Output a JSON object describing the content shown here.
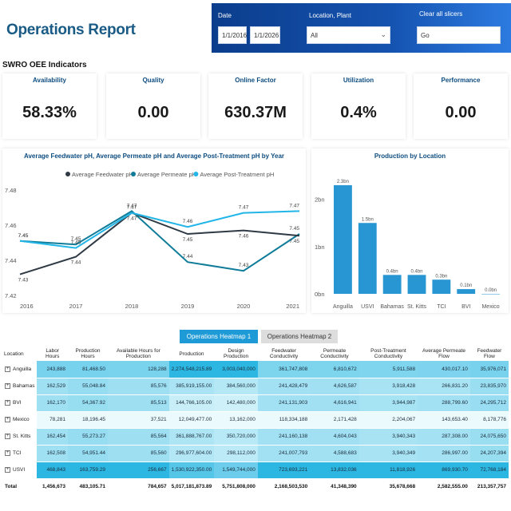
{
  "header": {
    "title": "Operations Report"
  },
  "slicers": {
    "date_label": "Date",
    "date_start": "1/1/2016",
    "date_end": "1/1/2026",
    "location_label": "Location, Plant",
    "location_value": "All",
    "clear_label": "Clear all slicers",
    "clear_button": "Go"
  },
  "kpis": {
    "section_title": "SWRO OEE Indicators",
    "items": [
      {
        "label": "Availability",
        "value": "58.33%"
      },
      {
        "label": "Quality",
        "value": "0.00"
      },
      {
        "label": "Online Factor",
        "value": "630.37M"
      },
      {
        "label": "Utilization",
        "value": "0.4%"
      },
      {
        "label": "Performance",
        "value": "0.00"
      }
    ]
  },
  "tabs": [
    {
      "label": "Operations Heatmap 1",
      "active": true
    },
    {
      "label": "Operations Heatmap 2",
      "active": false
    }
  ],
  "chart_data": [
    {
      "type": "line",
      "title": "Average Feedwater pH, Average Permeate pH and Average Post-Treatment pH by Year",
      "x": [
        "2016",
        "2017",
        "2018",
        "2019",
        "2020",
        "2021"
      ],
      "ylim": [
        7.42,
        7.48
      ],
      "yticks": [
        "7.48",
        "7.46",
        "7.44",
        "7.42"
      ],
      "legend_position": "top-center",
      "series": [
        {
          "name": "Average Feedwater pH",
          "color": "#2f3a45",
          "values": [
            7.432,
            7.442,
            7.467,
            7.455,
            7.457,
            7.454
          ],
          "labels": [
            "7.43",
            "7.44",
            "7.47",
            "7.45",
            "7.46",
            "7.45"
          ]
        },
        {
          "name": "Average Permeate pH",
          "color": "#0f7c99",
          "values": [
            7.451,
            7.449,
            7.468,
            7.439,
            7.434,
            7.455
          ],
          "labels": [
            "7.45",
            "7.45",
            "7.47",
            "7.44",
            "7.43",
            "7.45"
          ]
        },
        {
          "name": "Average Post-Treatment pH",
          "color": "#22b6e8",
          "values": [
            7.451,
            7.447,
            7.467,
            7.459,
            7.467,
            7.468
          ],
          "labels": [
            "7.45",
            "7.45",
            "7.47",
            "7.46",
            "7.47",
            "7.47"
          ]
        }
      ]
    },
    {
      "type": "bar",
      "title": "Production by Location",
      "categories": [
        "Anguilla",
        "USVI",
        "Bahamas",
        "St. Kitts",
        "TCI",
        "BVI",
        "Mexico"
      ],
      "values": [
        2.3,
        1.5,
        0.4,
        0.4,
        0.3,
        0.1,
        0.0
      ],
      "labels": [
        "2.3bn",
        "1.5bn",
        "0.4bn",
        "0.4bn",
        "0.3bn",
        "0.1bn",
        "0.0bn"
      ],
      "ylim": [
        0,
        2.4
      ],
      "yticks": [
        "0bn",
        "1bn",
        "2bn"
      ],
      "color": "#2796d3"
    }
  ],
  "heatmap": {
    "columns": [
      "Location",
      "Labor Hours",
      "Production Hours",
      "Available Hours for Production",
      "Production",
      "Design Production",
      "Feedwater Conductivity",
      "Permeate Conductivity",
      "Post-Treatment Conductivity",
      "Average Permeate Flow",
      "Feedwater Flow"
    ],
    "rows": [
      [
        "Anguilla",
        "243,888",
        "81,468.50",
        "128,288",
        "2,274,548,215.89",
        "3,003,040,000",
        "361,747,808",
        "6,810,672",
        "5,911,588",
        "430,017.10",
        "35,976,071"
      ],
      [
        "Bahamas",
        "162,529",
        "55,048.84",
        "85,576",
        "385,919,155.00",
        "384,560,000",
        "241,428,479",
        "4,626,587",
        "3,918,428",
        "266,831.20",
        "23,835,970"
      ],
      [
        "BVI",
        "162,170",
        "54,367.92",
        "85,513",
        "144,766,105.00",
        "142,480,000",
        "241,131,903",
        "4,616,941",
        "3,944,987",
        "288,799.60",
        "24,295,712"
      ],
      [
        "Mexico",
        "78,281",
        "18,196.45",
        "37,521",
        "12,049,477.00",
        "13,162,000",
        "118,334,188",
        "2,171,428",
        "2,204,067",
        "143,653.40",
        "8,178,776"
      ],
      [
        "St. Kitts",
        "162,454",
        "55,273.27",
        "85,564",
        "361,888,767.00",
        "350,720,000",
        "241,160,138",
        "4,604,043",
        "3,940,343",
        "287,308.00",
        "24,075,650"
      ],
      [
        "TCI",
        "162,508",
        "54,951.44",
        "85,560",
        "296,977,604.00",
        "298,112,000",
        "241,007,793",
        "4,588,683",
        "3,940,349",
        "286,997.00",
        "24,207,394"
      ],
      [
        "USVI",
        "468,843",
        "163,759.29",
        "256,667",
        "1,530,922,350.00",
        "1,549,744,000",
        "723,693,221",
        "13,832,036",
        "11,818,926",
        "869,930.70",
        "72,768,184"
      ]
    ],
    "total": [
      "Total",
      "1,456,673",
      "483,105.71",
      "784,657",
      "5,017,181,873.89",
      "5,751,808,000",
      "2,168,503,530",
      "41,348,390",
      "35,678,668",
      "2,582,555.00",
      "213,357,757"
    ]
  }
}
